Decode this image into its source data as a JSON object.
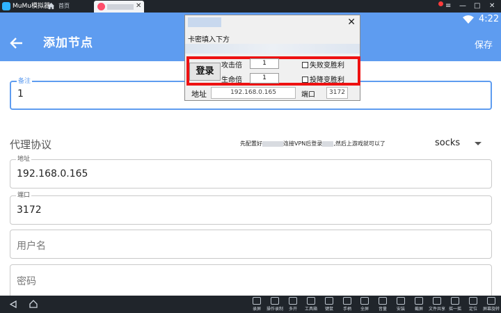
{
  "emulator": {
    "title": "MuMu模拟器",
    "home_label": "首页",
    "controls": [
      "≡",
      "—",
      "□",
      "✕"
    ],
    "toolbar": [
      {
        "label": "录屏",
        "icon": "record-icon"
      },
      {
        "label": "操作录制",
        "icon": "macro-icon"
      },
      {
        "label": "多开",
        "icon": "multi-instance-icon"
      },
      {
        "label": "工具箱",
        "icon": "toolbox-icon"
      },
      {
        "label": "键鼠",
        "icon": "keyboard-icon"
      },
      {
        "label": "手柄",
        "icon": "gamepad-icon"
      },
      {
        "label": "全屏",
        "icon": "fullscreen-icon"
      },
      {
        "label": "音量",
        "icon": "volume-icon"
      },
      {
        "label": "安装",
        "icon": "install-icon"
      },
      {
        "label": "截屏",
        "icon": "screenshot-icon"
      },
      {
        "label": "文件共享",
        "icon": "folder-icon"
      },
      {
        "label": "摇一摇",
        "icon": "shake-icon"
      },
      {
        "label": "定位",
        "icon": "location-icon"
      },
      {
        "label": "屏幕旋转",
        "icon": "rotate-icon"
      }
    ]
  },
  "status": {
    "time": "4:22"
  },
  "header": {
    "title": "添加节点",
    "save_label": "保存"
  },
  "form": {
    "remark": {
      "label": "备注",
      "value": "1"
    },
    "protocol": {
      "label": "代理协议",
      "selected": "socks"
    },
    "notice": {
      "prefix": "先配置好",
      "middle1": "连接VPN后登录",
      "suffix": ",然后上游戏就可以了"
    },
    "address": {
      "label": "地址",
      "value": "192.168.0.165"
    },
    "port": {
      "label": "端口",
      "value": "3172"
    },
    "username": {
      "placeholder": "用户名"
    },
    "password": {
      "placeholder": "密码"
    }
  },
  "popup": {
    "tip": "卡密填入下方",
    "login_label": "登录",
    "attack_label": "攻击倍",
    "attack_value": "1",
    "life_label": "生命倍",
    "life_value": "1",
    "lose_win_label": "失败变胜利",
    "surrender_win_label": "投降变胜利",
    "address_label": "地址",
    "address_value": "192.168.0.165",
    "port_label": "端口",
    "port_value": "3172",
    "close": "✕"
  },
  "colors": {
    "accent": "#5e9cf0",
    "highlight": "#ee1111",
    "emulator_bar": "#20252b"
  }
}
